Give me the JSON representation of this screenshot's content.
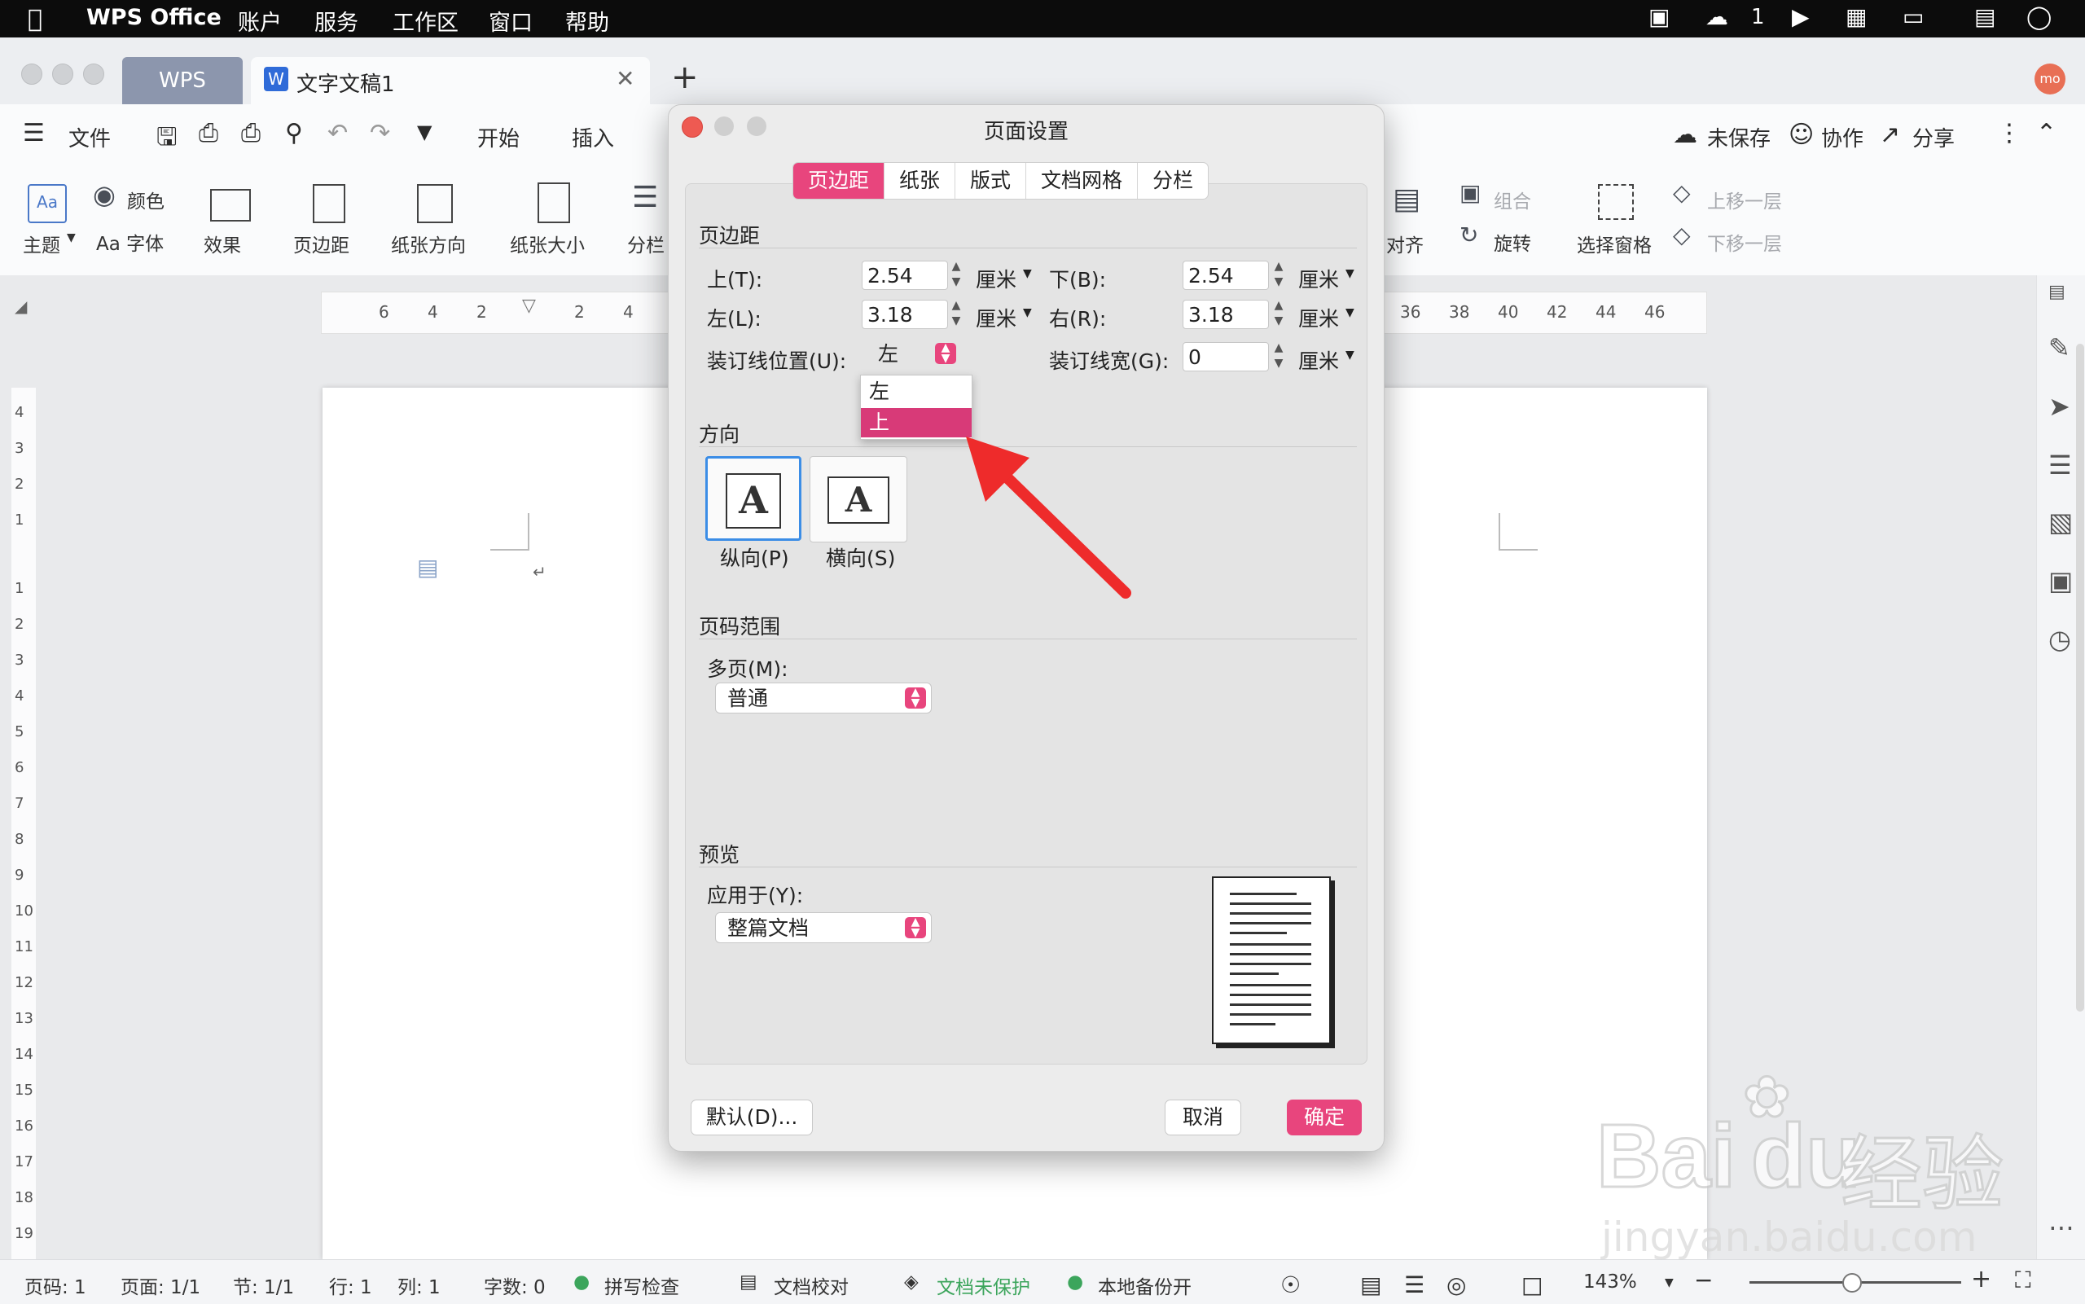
{
  "menubar": {
    "app_name": "WPS Office",
    "items": [
      "账户",
      "服务",
      "工作区",
      "窗口",
      "帮助"
    ],
    "wechat_count": "1"
  },
  "tabs": {
    "home": "WPS",
    "doc": "文字文稿1"
  },
  "avatar_text": "mo",
  "toolbar": {
    "file": "文件",
    "start": "开始",
    "insert": "插入",
    "unsaved": "未保存",
    "collab": "协作",
    "share": "分享"
  },
  "ribbon": {
    "theme": "主题",
    "color": "颜色",
    "font": "Aa 字体",
    "effect": "效果",
    "margins": "页边距",
    "orientation": "纸张方向",
    "size": "纸张大小",
    "columns": "分栏",
    "align": "对齐",
    "group": "组合",
    "rotate": "旋转",
    "select_pane": "选择窗格",
    "bring_forward": "上移一层",
    "send_backward": "下移一层"
  },
  "hruler_ticks_left": [
    "6",
    "4",
    "2",
    "2",
    "4"
  ],
  "hruler_ticks_right": [
    "36",
    "38",
    "40",
    "42",
    "44",
    "46"
  ],
  "vruler_ticks": [
    "4",
    "3",
    "2",
    "1",
    "1",
    "2",
    "3",
    "4",
    "5",
    "6",
    "7",
    "8",
    "9",
    "10",
    "11",
    "12",
    "13",
    "14",
    "15",
    "16",
    "17",
    "18",
    "19"
  ],
  "dialog": {
    "title": "页面设置",
    "tabs": [
      "页边距",
      "纸张",
      "版式",
      "文档网格",
      "分栏"
    ],
    "margins_section": "页边距",
    "top_label": "上(T):",
    "top_value": "2.54",
    "bottom_label": "下(B):",
    "bottom_value": "2.54",
    "left_label": "左(L):",
    "left_value": "3.18",
    "right_label": "右(R):",
    "right_value": "3.18",
    "unit": "厘米",
    "gutter_pos_label": "装订线位置(U):",
    "gutter_pos_value": "左",
    "gutter_width_label": "装订线宽(G):",
    "gutter_width_value": "0",
    "dropdown_options": [
      "左",
      "上"
    ],
    "orientation_section": "方向",
    "portrait": "纵向(P)",
    "landscape": "横向(S)",
    "orientation_glyph": "A",
    "page_range_section": "页码范围",
    "multi_page_label": "多页(M):",
    "multi_page_value": "普通",
    "preview_section": "预览",
    "apply_label": "应用于(Y):",
    "apply_value": "整篇文档",
    "default_btn": "默认(D)...",
    "cancel_btn": "取消",
    "ok_btn": "确定"
  },
  "status": {
    "page_num": "页码: 1",
    "pages": "页面: 1/1",
    "section": "节: 1/1",
    "row": "行: 1",
    "col": "列: 1",
    "words": "字数: 0",
    "spell": "拼写检查",
    "proof": "文档校对",
    "protect": "文档未保护",
    "backup": "本地备份开",
    "zoom": "143%"
  },
  "watermark": {
    "brand": "Bai",
    "brand2": "du",
    "brand3": "经验",
    "url": "jingyan.baidu.com"
  },
  "colors": {
    "accent": "#e8457d",
    "selection": "#d83a78",
    "arrow": "#ee2b2b"
  }
}
